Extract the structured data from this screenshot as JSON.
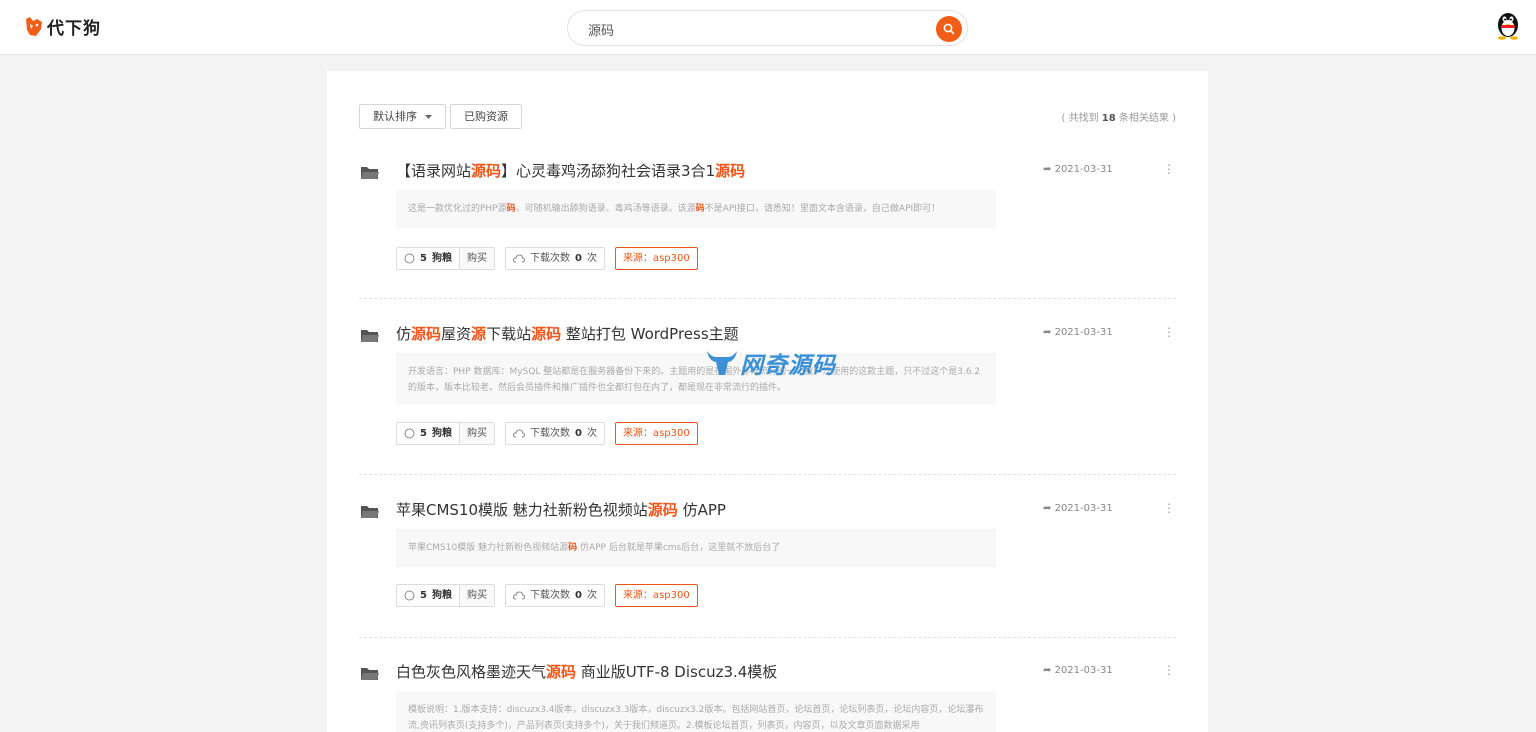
{
  "header": {
    "logo_text": "代下狗",
    "search": {
      "value": "源码",
      "placeholder": ""
    }
  },
  "toolbar": {
    "sort_label": "默认排序",
    "bought_label": "已购资源",
    "results_prefix": "( 共找到",
    "results_count": "18",
    "results_suffix": "条相关结果 )"
  },
  "watermark": {
    "text": "网奇源码"
  },
  "items": [
    {
      "title_parts": [
        "【语录网站",
        "源码",
        "】心灵毒鸡汤舔狗社会语录3合1",
        "源码",
        ""
      ],
      "date": "2021-03-31",
      "desc_parts": [
        "这是一款优化过的PHP源",
        "码",
        "，可随机输出舔狗语录、毒鸡汤等语录。该源",
        "码",
        "不是API接口，请悉知！里面文本含语录，自己做API即可！"
      ],
      "price_value": "5",
      "price_unit": "狗粮",
      "buy_label": "购买",
      "downloads_prefix": "下载次数",
      "downloads_count": "0",
      "downloads_suffix": "次",
      "source_label": "来源：asp300"
    },
    {
      "title_parts": [
        "仿",
        "源码",
        "屋资",
        "源",
        "下载站",
        "源码",
        " 整站打包 WordPress主题"
      ],
      "date": "2021-03-31",
      "desc_text": "开发语言：PHP 数据库：MySQL 整站都是在服务器备份下来的。主题用的是在国外非常流行的一个被广泛使用的这款主题，只不过这个是3.6.2的版本，版本比较老。然后会员插件和推广插件也全都打包在内了，都是现在非常流行的插件。",
      "price_value": "5",
      "price_unit": "狗粮",
      "buy_label": "购买",
      "downloads_prefix": "下载次数",
      "downloads_count": "0",
      "downloads_suffix": "次",
      "source_label": "来源：asp300"
    },
    {
      "title_parts": [
        "苹果CMS10模版 魅力社新粉色视频站",
        "源码",
        " 仿APP"
      ],
      "date": "2021-03-31",
      "desc_parts": [
        "苹果CMS10模版 魅力社新粉色视频站源",
        "码",
        " 仿APP 后台就是苹果cms后台，这里就不放后台了"
      ],
      "price_value": "5",
      "price_unit": "狗粮",
      "buy_label": "购买",
      "downloads_prefix": "下载次数",
      "downloads_count": "0",
      "downloads_suffix": "次",
      "source_label": "来源：asp300"
    },
    {
      "title_parts": [
        "白色灰色风格墨迹天气",
        "源码",
        " 商业版UTF-8 Discuz3.4模板"
      ],
      "date": "2021-03-31",
      "desc_text": "模板说明：1.版本支持：discuzx3.4版本，discuzx3.3版本，discuzx3.2版本。包括网站首页，论坛首页，论坛列表页，论坛内容页，论坛瀑布流,资讯列表页(支持多个)，产品列表页(支持多个)，关于我们频道页。2.模板论坛首页，列表页，内容页，以及文章页面数据采用"
    }
  ]
}
